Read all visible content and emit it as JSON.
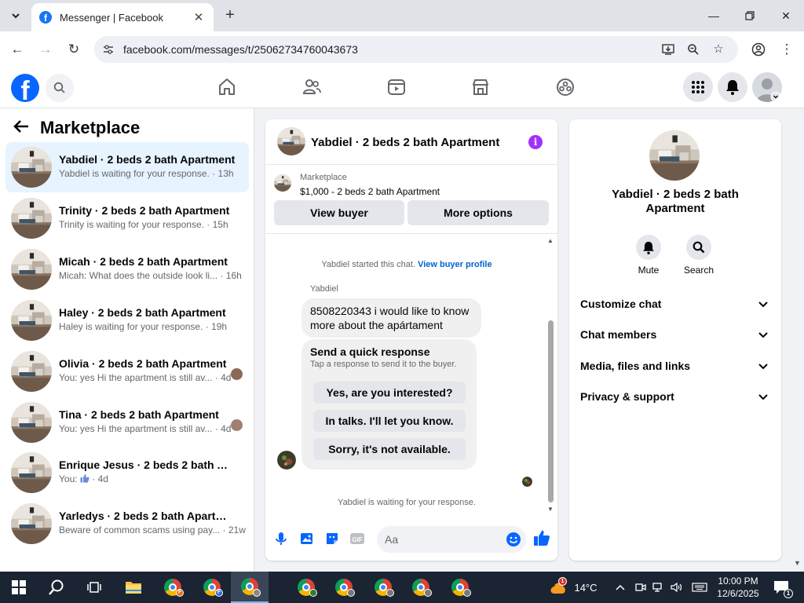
{
  "browser": {
    "tab_title": "Messenger | Facebook",
    "url": "facebook.com/messages/t/25062734760043673",
    "tab_menu_icon": "chevron-down-icon",
    "new_tab_icon": "plus-icon"
  },
  "colors": {
    "facebook_blue": "#0866ff",
    "selected_row": "#e7f3ff",
    "info_purple": "#a033f7",
    "link_blue": "#0064d1",
    "taskbar": "#1b2432"
  },
  "left_panel": {
    "title": "Marketplace",
    "conversations": [
      {
        "name": "Yabdiel · 2 beds 2 bath Apartment",
        "preview": "Yabdiel is waiting for your response. · 13h",
        "selected": true
      },
      {
        "name": "Trinity · 2 beds 2 bath Apartment",
        "preview": "Trinity is waiting for your response. · 15h"
      },
      {
        "name": "Micah · 2 beds 2 bath Apartment",
        "preview": "Micah: What does the outside look li... · 16h"
      },
      {
        "name": "Haley · 2 beds 2 bath Apartment",
        "preview": "Haley is waiting for your response. · 19h"
      },
      {
        "name": "Olivia · 2 beds 2 bath Apartment",
        "preview": "You: yes Hi the apartment is still av... · 4d"
      },
      {
        "name": "Tina · 2 beds 2 bath Apartment",
        "preview": "You: yes Hi the apartment is still av... · 4d"
      },
      {
        "name": "Enrique Jesus · 2 beds 2 bath Apar...",
        "preview_prefix": "You: ",
        "preview_icon": "thumbs-up-icon",
        "preview_suffix": " · 4d"
      },
      {
        "name": "Yarledys · 2 beds 2 bath Apartment",
        "preview": "Beware of common scams using pay... · 21w"
      }
    ]
  },
  "chat": {
    "title": "Yabdiel · 2 beds 2 bath Apartment",
    "context_label": "Marketplace",
    "context_price": "$1,000 - 2 beds 2 bath Apartment",
    "view_buyer": "View buyer",
    "more_options": "More options",
    "system_started": "Yabdiel started this chat. ",
    "system_link": "View buyer profile",
    "sender": "Yabdiel",
    "message": "8508220343 i would like to know more about the apártament",
    "quick_title": "Send a quick response",
    "quick_subtitle": "Tap a response to send it to the buyer.",
    "quick_options": [
      "Yes, are you interested?",
      "In talks. I'll let you know.",
      "Sorry, it's not available."
    ],
    "waiting": "Yabdiel is waiting for your response.",
    "composer_placeholder": "Aa"
  },
  "info_panel": {
    "name": "Yabdiel · 2 beds 2 bath Apartment",
    "mute": "Mute",
    "search": "Search",
    "sections": [
      "Customize chat",
      "Chat members",
      "Media, files and links",
      "Privacy & support"
    ]
  },
  "taskbar": {
    "temperature": "14°C",
    "time": "10:00 PM",
    "date": "12/6/2025",
    "weather_badge": "1",
    "notification_count": "1"
  }
}
